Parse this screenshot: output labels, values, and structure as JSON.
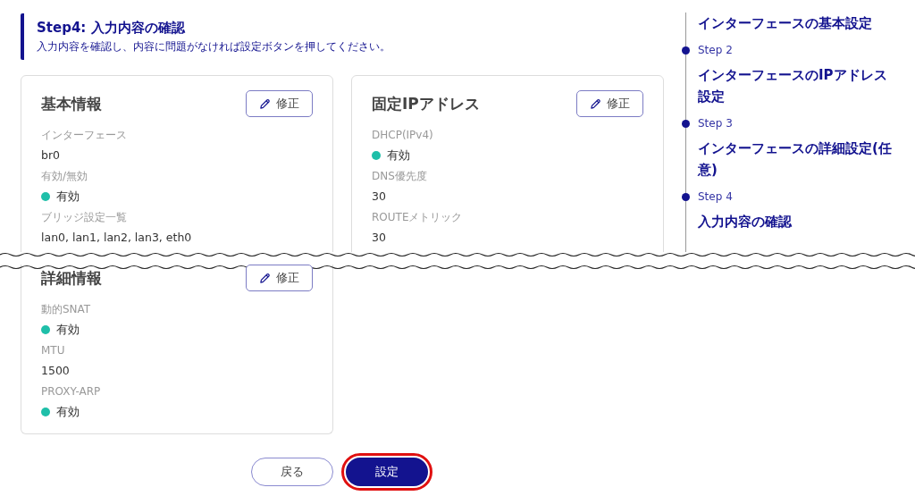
{
  "header": {
    "title": "Step4: 入力内容の確認",
    "description": "入力内容を確認し、内容に問題がなければ設定ボタンを押してください。"
  },
  "cards": [
    {
      "title": "基本情報",
      "edit_button": "修正",
      "fields": [
        {
          "label": "インターフェース",
          "value": "br0",
          "kind": "text"
        },
        {
          "label": "有効/無効",
          "value": "有効",
          "kind": "status"
        },
        {
          "label": "ブリッジ設定一覧",
          "value": "lan0, lan1, lan2, lan3, eth0",
          "kind": "text"
        }
      ]
    },
    {
      "title": "固定IPアドレス",
      "edit_button": "修正",
      "fields": [
        {
          "label": "DHCP(IPv4)",
          "value": "有効",
          "kind": "status"
        },
        {
          "label": "DNS優先度",
          "value": "30",
          "kind": "text"
        },
        {
          "label": "ROUTEメトリック",
          "value": "30",
          "kind": "text"
        }
      ]
    }
  ],
  "detail_card": {
    "title": "詳細情報",
    "edit_button": "修正",
    "fields": [
      {
        "label": "動的SNAT",
        "value": "有効",
        "kind": "status"
      },
      {
        "label": "MTU",
        "value": "1500",
        "kind": "text"
      },
      {
        "label": "PROXY-ARP",
        "value": "有効",
        "kind": "status"
      }
    ]
  },
  "stepper": {
    "steps": [
      {
        "title": "インターフェースの基本設定"
      },
      {
        "label": "Step 2",
        "title": "インターフェースのIPアドレス設定"
      },
      {
        "label": "Step 3",
        "title": "インターフェースの詳細設定(任意)"
      },
      {
        "label": "Step 4",
        "title": "入力内容の確認"
      }
    ]
  },
  "buttons": [
    {
      "label": "戻る",
      "kind": "secondary",
      "highlighted": false
    },
    {
      "label": "設定",
      "kind": "primary",
      "highlighted": true
    }
  ]
}
